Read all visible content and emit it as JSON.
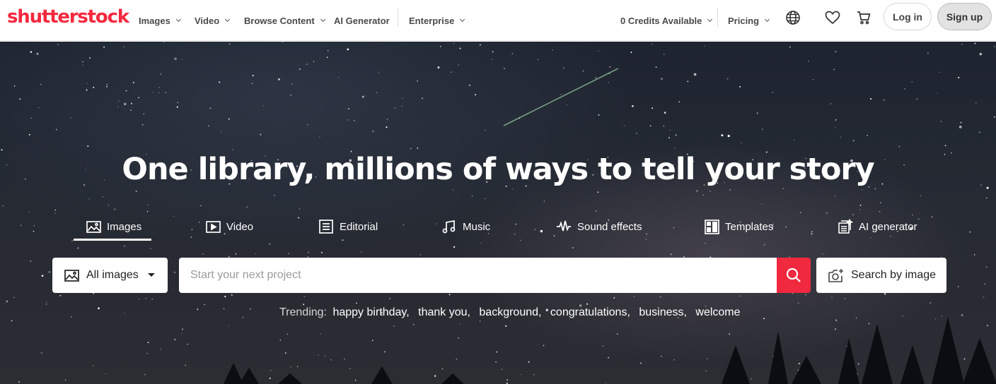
{
  "header": {
    "logo_text": "shutterstock",
    "nav": [
      {
        "label": "Images"
      },
      {
        "label": "Video"
      },
      {
        "label": "Browse Content"
      },
      {
        "label": "AI Generator"
      },
      {
        "label": "Enterprise"
      }
    ],
    "credits": "0 Credits Available",
    "pricing": "Pricing",
    "icons": [
      "globe-icon",
      "heart-icon",
      "cart-icon"
    ],
    "login": "Log in",
    "signup": "Sign up"
  },
  "hero": {
    "headline": "One library, millions of ways to tell your story",
    "tabs": [
      {
        "label": "Images",
        "icon": "image-icon",
        "active": true
      },
      {
        "label": "Video",
        "icon": "video-icon"
      },
      {
        "label": "Editorial",
        "icon": "editorial-icon"
      },
      {
        "label": "Music",
        "icon": "music-icon"
      },
      {
        "label": "Sound effects",
        "icon": "sound-wave-icon"
      },
      {
        "label": "Templates",
        "icon": "templates-icon"
      },
      {
        "label": "AI generator",
        "icon": "ai-generator-icon"
      }
    ],
    "search": {
      "filter": "All images",
      "placeholder": "Start your next project",
      "value": "",
      "image_search": "Search by image"
    },
    "trending": {
      "label": "Trending:",
      "terms": [
        "happy birthday,",
        "thank you,",
        "background,",
        "congratulations,",
        "business,",
        "welcome"
      ]
    }
  },
  "colors": {
    "brand": "#f5283e",
    "search_button": "#f0293e"
  }
}
